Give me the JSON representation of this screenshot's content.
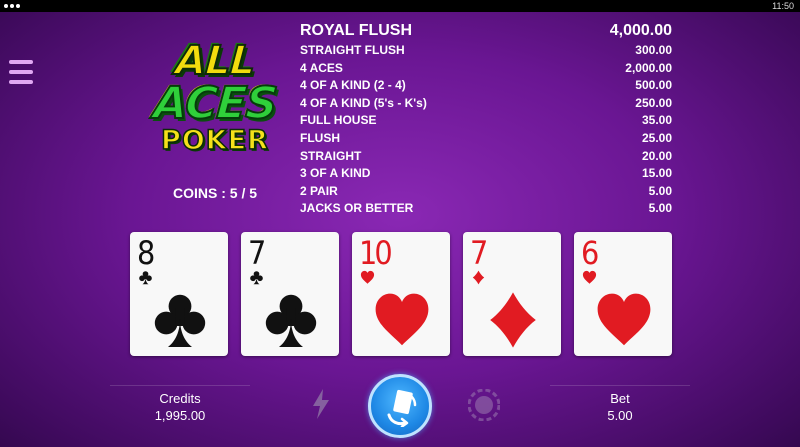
{
  "statusbar": {
    "time": "11:50"
  },
  "logo": {
    "line1": "ALL",
    "line2": "ACES",
    "line3": "POKER"
  },
  "coins": {
    "label": "COINS :",
    "value": "5 / 5"
  },
  "paytable": [
    {
      "hand": "ROYAL FLUSH",
      "payout": "4,000.00"
    },
    {
      "hand": "STRAIGHT FLUSH",
      "payout": "300.00"
    },
    {
      "hand": "4 ACES",
      "payout": "2,000.00"
    },
    {
      "hand": "4 OF A KIND (2 - 4)",
      "payout": "500.00"
    },
    {
      "hand": "4 OF A KIND (5's - K's)",
      "payout": "250.00"
    },
    {
      "hand": "FULL HOUSE",
      "payout": "35.00"
    },
    {
      "hand": "FLUSH",
      "payout": "25.00"
    },
    {
      "hand": "STRAIGHT",
      "payout": "20.00"
    },
    {
      "hand": "3 OF A KIND",
      "payout": "15.00"
    },
    {
      "hand": "2 PAIR",
      "payout": "5.00"
    },
    {
      "hand": "JACKS OR BETTER",
      "payout": "5.00"
    }
  ],
  "cards": [
    {
      "rank": "8",
      "suit": "clubs",
      "color": "black"
    },
    {
      "rank": "7",
      "suit": "clubs",
      "color": "black"
    },
    {
      "rank": "10",
      "suit": "hearts",
      "color": "red"
    },
    {
      "rank": "7",
      "suit": "diamonds",
      "color": "red"
    },
    {
      "rank": "6",
      "suit": "hearts",
      "color": "red"
    }
  ],
  "credits": {
    "label": "Credits",
    "value": "1,995.00"
  },
  "bet": {
    "label": "Bet",
    "value": "5.00"
  },
  "icons": {
    "menu": "hamburger-menu-icon",
    "autoplay": "lightning-bolt-icon",
    "deal": "deal-cards-icon",
    "chip": "poker-chip-icon"
  },
  "colors": {
    "background": "#6a1693",
    "deal_button": "#1e88e5",
    "red_suit": "#e11b22",
    "black_suit": "#111111"
  }
}
